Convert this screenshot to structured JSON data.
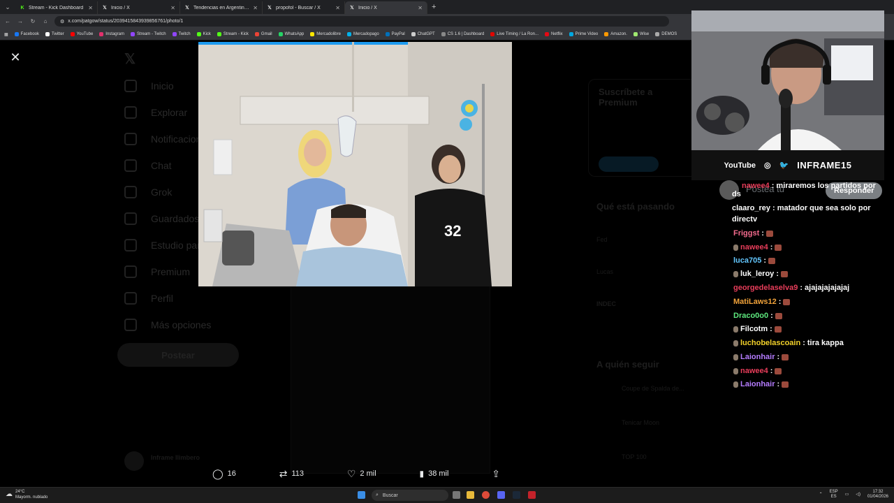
{
  "browser": {
    "tabs": [
      {
        "label": "Stream - Kick Dashboard",
        "icon": "kick-icon",
        "active": false
      },
      {
        "label": "Inicio / X",
        "icon": "x-icon",
        "active": false
      },
      {
        "label": "Tendencias en Argentina en X",
        "icon": "x-icon",
        "active": false
      },
      {
        "label": "propofol - Buscar / X",
        "icon": "x-icon",
        "active": false
      },
      {
        "label": "Inicio / X",
        "icon": "x-icon",
        "active": true
      }
    ],
    "url": "x.com/patgow/status/2039415843939856761/photo/1",
    "bookmarks": [
      {
        "label": "Facebook",
        "color": "#1877f2"
      },
      {
        "label": "Twitter",
        "color": "#ffffff"
      },
      {
        "label": "YouTube",
        "color": "#ff0000"
      },
      {
        "label": "Instagram",
        "color": "#e1306c"
      },
      {
        "label": "Stream - Twitch",
        "color": "#9146ff"
      },
      {
        "label": "Twitch",
        "color": "#9146ff"
      },
      {
        "label": "Kick",
        "color": "#53fc18"
      },
      {
        "label": "Stream - Kick",
        "color": "#53fc18"
      },
      {
        "label": "Gmail",
        "color": "#ea4335"
      },
      {
        "label": "WhatsApp",
        "color": "#25d366"
      },
      {
        "label": "Mercadolibre",
        "color": "#ffe600"
      },
      {
        "label": "Mercadopago",
        "color": "#00b1ea"
      },
      {
        "label": "PayPal",
        "color": "#0070ba"
      },
      {
        "label": "ChatGPT",
        "color": "#cccccc"
      },
      {
        "label": "CS 1.6 | Dashboard",
        "color": "#888888"
      },
      {
        "label": "Live Timing / La Ron...",
        "color": "#e10600"
      },
      {
        "label": "Netflix",
        "color": "#e50914"
      },
      {
        "label": "Prime Video",
        "color": "#00a8e1"
      },
      {
        "label": "Amazon.",
        "color": "#ff9900"
      },
      {
        "label": "Wise",
        "color": "#9fe870"
      },
      {
        "label": "DEMOS",
        "color": "#aaaaaa"
      }
    ]
  },
  "x_page": {
    "nav": [
      "Inicio",
      "Explorar",
      "Notificaciones",
      "Chat",
      "Grok",
      "Guardados",
      "Estudio para creadores",
      "Premium",
      "Perfil",
      "Más opciones"
    ],
    "post_button": "Postear",
    "premium_title": "Suscríbete a Premium",
    "trending_title": "Qué está pasando",
    "trending_items": [
      "Fed",
      "Lucas",
      "INDEC"
    ],
    "follow_title": "A quién seguir",
    "follow_items": [
      "Coupe de Spalda de...",
      "Tenicar Moon",
      "TOP 100"
    ],
    "account_name": "Inframe Ilimbero"
  },
  "actions": {
    "replies": "16",
    "reposts": "113",
    "likes": "2 mil",
    "views": "38 mil"
  },
  "stream": {
    "socials_label": "YouTube",
    "channel": "INFRAME15",
    "reply_placeholder": "Postea tu",
    "reply_button": "Responder"
  },
  "chat": [
    {
      "user": "nawee4",
      "color": "#e83d5a",
      "text": "miraremos los partidos por",
      "emote": false
    },
    {
      "user": "ds",
      "color": "#ffffff",
      "text": "",
      "emote": false
    },
    {
      "user": "claaro_rey",
      "color": "#ffffff",
      "text": "matador que sea solo por",
      "emote": false
    },
    {
      "user": "",
      "color": "#ffffff",
      "text": "directv",
      "emote": false
    },
    {
      "user": "Friggst",
      "color": "#f56b8e",
      "text": "",
      "emote": true
    },
    {
      "user": "nawee4",
      "color": "#e83d5a",
      "text": "",
      "emote": true
    },
    {
      "user": "luca705",
      "color": "#63c7ff",
      "text": "",
      "emote": true
    },
    {
      "user": "luk_leroy",
      "color": "#ffffff",
      "text": "",
      "emote": true
    },
    {
      "user": "georgedelaselva9",
      "color": "#e83d5a",
      "text": "ajajajajajajaj",
      "emote": false
    },
    {
      "user": "MatiLaws12",
      "color": "#f2a33a",
      "text": "",
      "emote": true
    },
    {
      "user": "Draco0o0",
      "color": "#5ee87e",
      "text": "",
      "emote": true
    },
    {
      "user": "Filcotm",
      "color": "#ffffff",
      "text": "",
      "emote": true
    },
    {
      "user": "luchobelascoain",
      "color": "#f2d12a",
      "text": "tira kappa",
      "emote": false
    },
    {
      "user": "Laionhair",
      "color": "#b57cff",
      "text": "",
      "emote": true
    },
    {
      "user": "nawee4",
      "color": "#e83d5a",
      "text": "",
      "emote": true
    },
    {
      "user": "Laionhair",
      "color": "#b57cff",
      "text": "",
      "emote": true
    }
  ],
  "taskbar": {
    "temperature": "24°C",
    "weather": "Mayorm. nublado",
    "search": "Buscar",
    "lang": "ESP",
    "lang_sub": "ES",
    "time": "17:32",
    "date": "01/04/2026"
  }
}
